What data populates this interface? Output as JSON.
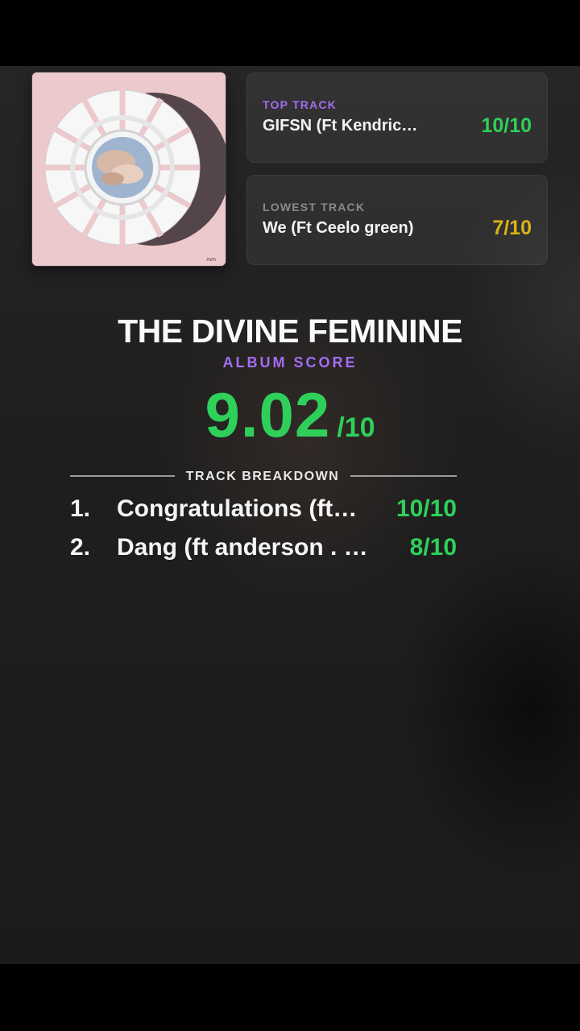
{
  "album": {
    "title": "THE DIVINE FEMININE",
    "score_label": "ALBUM SCORE",
    "score": "9.02",
    "score_denominator": "/10"
  },
  "cover": {
    "icon": "album-cover-art",
    "bg_color": "#ecc9cc"
  },
  "top_track": {
    "label": "TOP TRACK",
    "title": "GIFSN (Ft Kendric…",
    "score": "10/10",
    "color": "#2fd05a"
  },
  "lowest_track": {
    "label": "LOWEST TRACK",
    "title": "We (Ft Ceelo green)",
    "score": "7/10",
    "color": "#d9b21a"
  },
  "breakdown": {
    "label": "TRACK BREAKDOWN",
    "tracks": [
      {
        "number": "1.",
        "name": "Congratulations (ft…",
        "score": "10/10"
      },
      {
        "number": "2.",
        "name": "Dang (ft anderson . …",
        "score": "8/10"
      }
    ]
  },
  "colors": {
    "accent_purple": "#a46df2",
    "score_green": "#2fd05a",
    "low_yellow": "#d9b21a"
  }
}
